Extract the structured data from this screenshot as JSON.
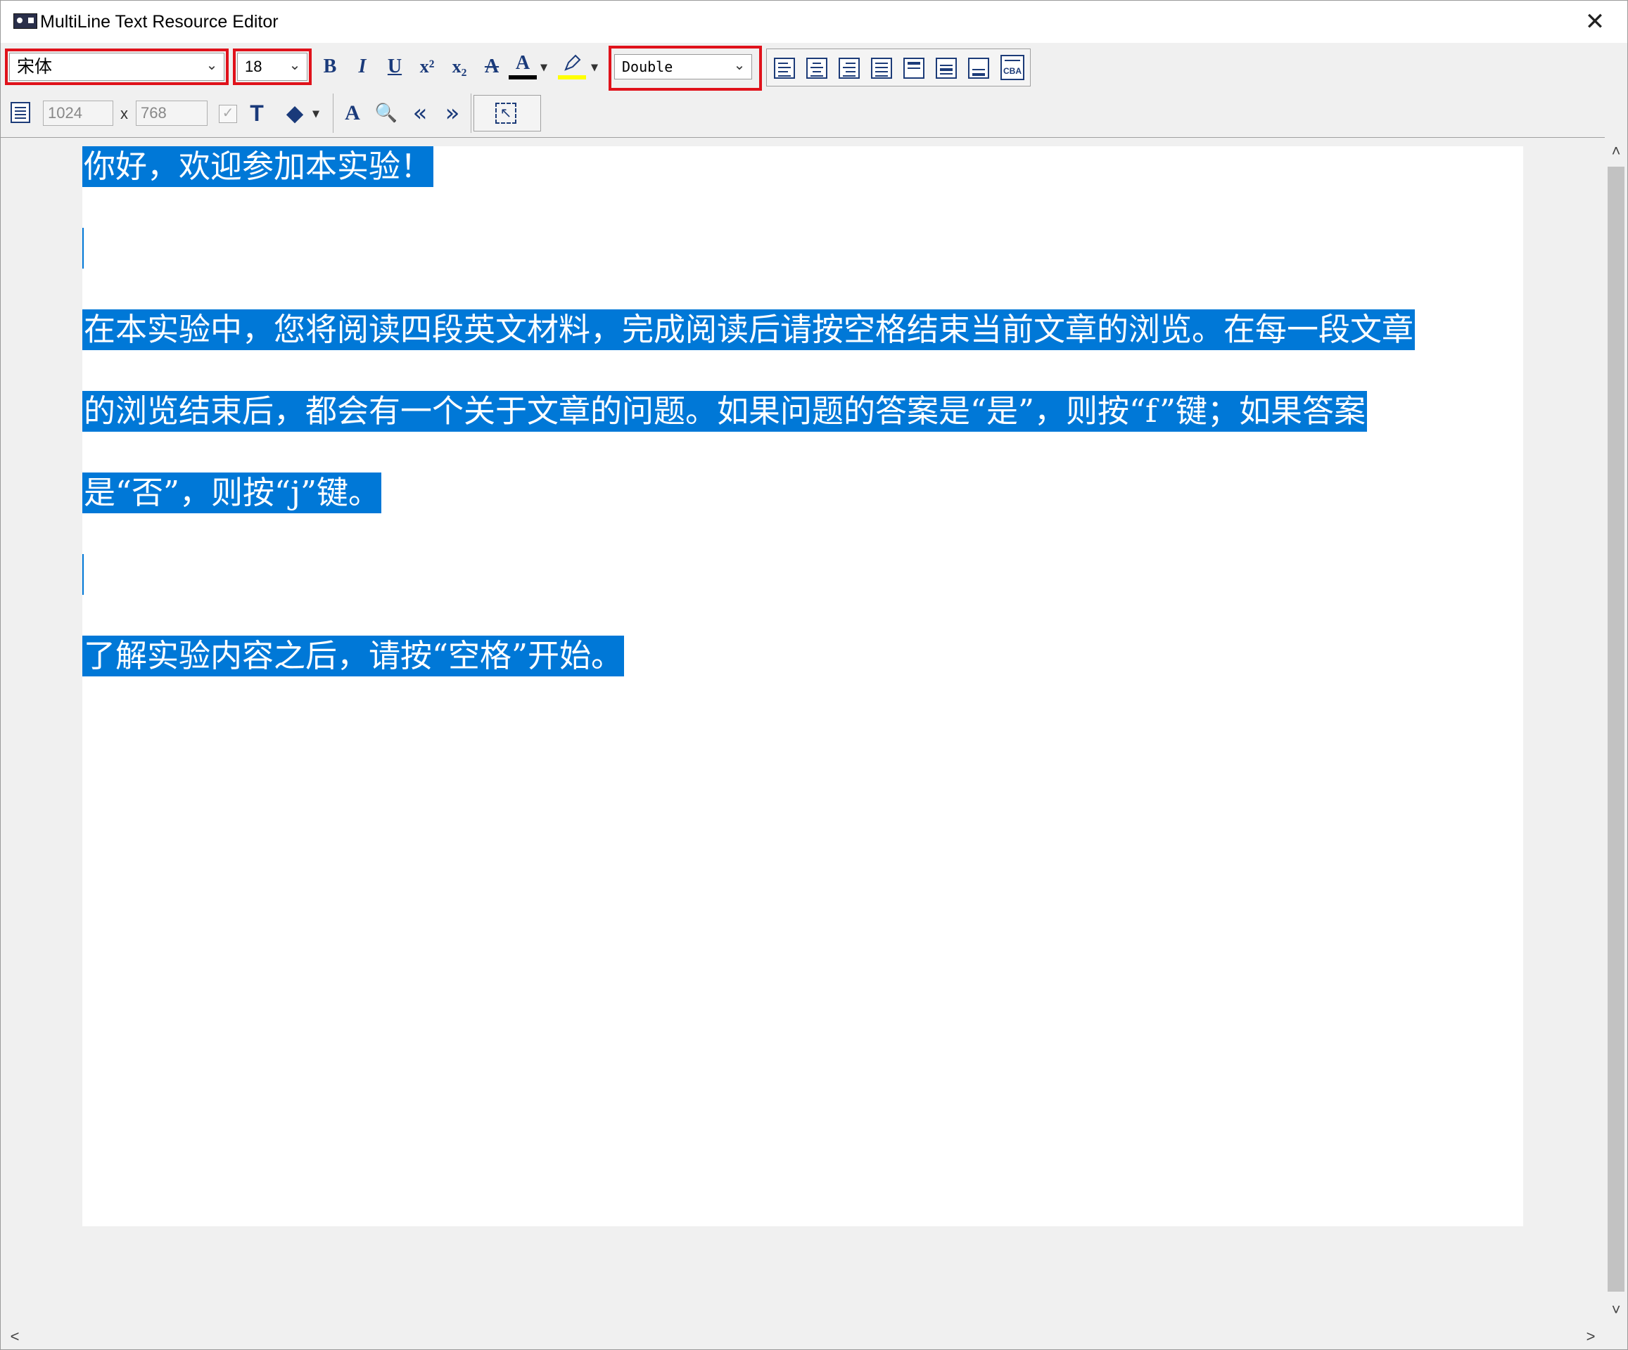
{
  "window": {
    "title": "MultiLine Text Resource Editor",
    "close_glyph": "✕"
  },
  "toolbar": {
    "font_name": "宋体",
    "font_size": "18",
    "line_spacing": "Double",
    "bold": "B",
    "italic": "I",
    "underline": "U",
    "superscript": "x²",
    "subscript": "x₂",
    "strikethrough": "A",
    "font_color": "A",
    "highlight_colors": {
      "text": "#000000",
      "marker": "#ffff00"
    },
    "width": "1024",
    "height": "768",
    "size_separator": "x",
    "text_button": "T",
    "prev": "«",
    "next": "»"
  },
  "editor": {
    "lines": [
      {
        "text": "你好，欢迎参加本实验！",
        "selected": true
      },
      {
        "text": "",
        "selected": false
      },
      {
        "text": "在本实验中，您将阅读四段英文材料，完成阅读后请按空格结束当前文章的浏览。在每一段文章",
        "selected": true
      },
      {
        "text": "的浏览结束后，都会有一个关于文章的问题。如果问题的答案是“是”，则按“f”键；如果答案",
        "selected": true
      },
      {
        "text": "是“否”，则按“j”键。",
        "selected": true
      },
      {
        "text": "",
        "selected": false
      },
      {
        "text": "了解实验内容之后，请按“空格”开始。",
        "selected": true
      }
    ],
    "selection_color": "#0078d7"
  },
  "scrollbar": {
    "up": "˄",
    "down": "˅",
    "left": "<",
    "right": ">"
  }
}
